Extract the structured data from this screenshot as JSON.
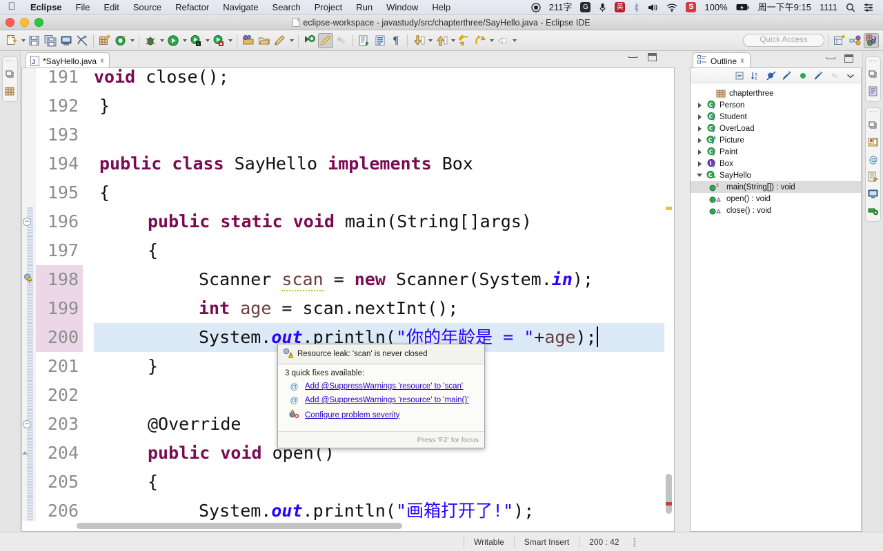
{
  "macbar": {
    "apple_icon": "apple-logo",
    "menus": [
      "Eclipse",
      "File",
      "Edit",
      "Source",
      "Refactor",
      "Navigate",
      "Search",
      "Project",
      "Run",
      "Window",
      "Help"
    ],
    "right": {
      "record_icon": "record-circle-icon",
      "input_count": "211字",
      "input_badge": "G",
      "mic_icon": "microphone-icon",
      "lang_badge": "英",
      "bluetooth_icon": "bluetooth-icon",
      "volume_icon": "volume-icon",
      "wifi_icon": "wifi-icon",
      "sogou_badge": "S",
      "battery_pct": "100%",
      "battery_icon": "battery-charging-icon",
      "clock": "周一下午9:15",
      "user": "1111",
      "search_icon": "spotlight-search-icon",
      "control_center_icon": "control-center-icon"
    }
  },
  "window": {
    "title": "eclipse-workspace - javastudy/src/chapterthree/SayHello.java - Eclipse IDE",
    "doc_icon": "document-icon",
    "traffic": [
      "close-button",
      "minimize-button",
      "zoom-button"
    ]
  },
  "toolbar": {
    "quick_access_placeholder": "Quick Access",
    "items": [
      "new-wizard-icon",
      "save-icon",
      "save-all-icon",
      "print-icon",
      "toggle-mark-occurrences-icon",
      "new-java-package-icon",
      "open-type-icon",
      "debug-icon",
      "run-icon",
      "coverage-icon",
      "external-tools-icon",
      "open-task-icon",
      "open-folder-icon",
      "edit-icon",
      "search-icon",
      "toggle-java-editor-icon",
      "link-icon",
      "next-annotation-icon",
      "previous-annotation-icon",
      "pilcrow-icon",
      "back-icon",
      "forward-icon",
      "undo-icon",
      "redo-icon"
    ],
    "perspective_icons": [
      "open-perspective-icon",
      "java-perspective-icon",
      "java-ee-perspective-icon"
    ]
  },
  "editor": {
    "tab": {
      "label": "*SayHello.java",
      "file_icon": "java-file-icon",
      "close_icon": "close-icon"
    },
    "minimize_icon": "minimize-icon",
    "maximize_icon": "maximize-icon",
    "lines": [
      {
        "num": "191",
        "indent": 0,
        "html_key": "l191"
      },
      {
        "num": "192",
        "indent": 0,
        "html_key": "l192"
      },
      {
        "num": "193",
        "indent": 0,
        "html_key": "l193"
      },
      {
        "num": "194",
        "indent": 0,
        "html_key": "l194"
      },
      {
        "num": "195",
        "indent": 0,
        "html_key": "l195"
      },
      {
        "num": "196",
        "indent": 0,
        "html_key": "l196"
      },
      {
        "num": "197",
        "indent": 0,
        "html_key": "l197"
      },
      {
        "num": "198",
        "indent": 0,
        "html_key": "l198"
      },
      {
        "num": "199",
        "indent": 0,
        "html_key": "l199"
      },
      {
        "num": "200",
        "indent": 0,
        "html_key": "l200"
      },
      {
        "num": "201",
        "indent": 0,
        "html_key": "l201"
      },
      {
        "num": "202",
        "indent": 0,
        "html_key": "l202"
      },
      {
        "num": "203",
        "indent": 0,
        "html_key": "l203"
      },
      {
        "num": "204",
        "indent": 0,
        "html_key": "l204"
      },
      {
        "num": "205",
        "indent": 0,
        "html_key": "l205"
      },
      {
        "num": "206",
        "indent": 0,
        "html_key": "l206"
      }
    ],
    "line_numbers": {
      "n191": "191",
      "n192": "192",
      "n193": "193",
      "n194": "194",
      "n195": "195",
      "n196": "196",
      "n197": "197",
      "n198": "198",
      "n199": "199",
      "n200": "200",
      "n201": "201",
      "n202": "202",
      "n203": "203",
      "n204": "204",
      "n205": "205",
      "n206": "206"
    },
    "code_text": {
      "c191": "    void close();",
      "c192": "}",
      "c193": "",
      "c194": "public class SayHello implements Box",
      "c195": "{",
      "c196": "    public static void main(String[]args)",
      "c197": "    {",
      "c198": "        Scanner scan = new Scanner(System.in);",
      "c199": "        int age = scan.nextInt();",
      "c200": "        System.out.println(\"你的年龄是 = \"+age);",
      "c201": "    }",
      "c202": "",
      "c203": "    @Override",
      "c204": "    public void open()",
      "c205": "    {",
      "c206": "        System.out.println(\"画箱打开了!\");"
    },
    "current_line": "200",
    "warning_line": "198",
    "warning_gutter_icon": "warning-marker-icon",
    "override_marker_icon": "override-indicator-icon"
  },
  "popup": {
    "warning_icon": "warning-icon",
    "title": "Resource leak: 'scan' is never closed",
    "subtitle": "3 quick fixes available:",
    "fixes": [
      {
        "icon": "annotation-at-icon",
        "label": "Add @SuppressWarnings 'resource' to 'scan'"
      },
      {
        "icon": "annotation-at-icon",
        "label": "Add @SuppressWarnings 'resource' to 'main()'"
      },
      {
        "icon": "configure-severity-icon",
        "label": "Configure problem severity"
      }
    ],
    "footer": "Press 'F2' for focus"
  },
  "outline": {
    "tab_label": "Outline",
    "tab_icon": "outline-icon",
    "close_icon": "close-icon",
    "minimize_icon": "minimize-icon",
    "maximize_icon": "maximize-icon",
    "toolbar_icons": [
      "collapse-all-icon",
      "sort-icon",
      "hide-fields-icon",
      "hide-static-icon",
      "hide-non-public-icon",
      "hide-local-types-icon",
      "more-icon",
      "view-menu-icon"
    ],
    "tree": [
      {
        "label": "chapterthree",
        "icon": "package-icon",
        "twisty": "none",
        "indent": 1,
        "selected": false
      },
      {
        "label": "Person",
        "icon": "class-icon",
        "twisty": "collapsed",
        "indent": 0,
        "selected": false
      },
      {
        "label": "Student",
        "icon": "class-icon",
        "twisty": "collapsed",
        "indent": 0,
        "selected": false
      },
      {
        "label": "OverLoad",
        "icon": "class-icon",
        "twisty": "collapsed",
        "indent": 0,
        "selected": false
      },
      {
        "label": "Picture",
        "icon": "abstract-class-icon",
        "twisty": "collapsed",
        "indent": 0,
        "selected": false
      },
      {
        "label": "Paint",
        "icon": "class-icon",
        "twisty": "collapsed",
        "indent": 0,
        "selected": false
      },
      {
        "label": "Box",
        "icon": "interface-icon",
        "twisty": "collapsed",
        "indent": 0,
        "selected": false
      },
      {
        "label": "SayHello",
        "icon": "class-icon",
        "twisty": "expanded",
        "indent": 0,
        "selected": false
      },
      {
        "label": "main(String[]) : void",
        "icon": "public-static-method-icon",
        "twisty": "none",
        "indent": 2,
        "selected": true
      },
      {
        "label": "open() : void",
        "icon": "public-method-icon",
        "twisty": "none",
        "indent": 2,
        "selected": false
      },
      {
        "label": "close() : void",
        "icon": "public-method-icon",
        "twisty": "none",
        "indent": 2,
        "selected": false
      }
    ]
  },
  "status": {
    "writable": "Writable",
    "insert_mode": "Smart Insert",
    "position": "200 : 42"
  },
  "colors": {
    "keyword": "#7b0a52",
    "field": "#2a00ff",
    "string": "#2a00ff",
    "annotation": "#646464",
    "current_line": "#dce9f7",
    "marker_line": "#ecd7e8",
    "link": "#2a00c8"
  }
}
